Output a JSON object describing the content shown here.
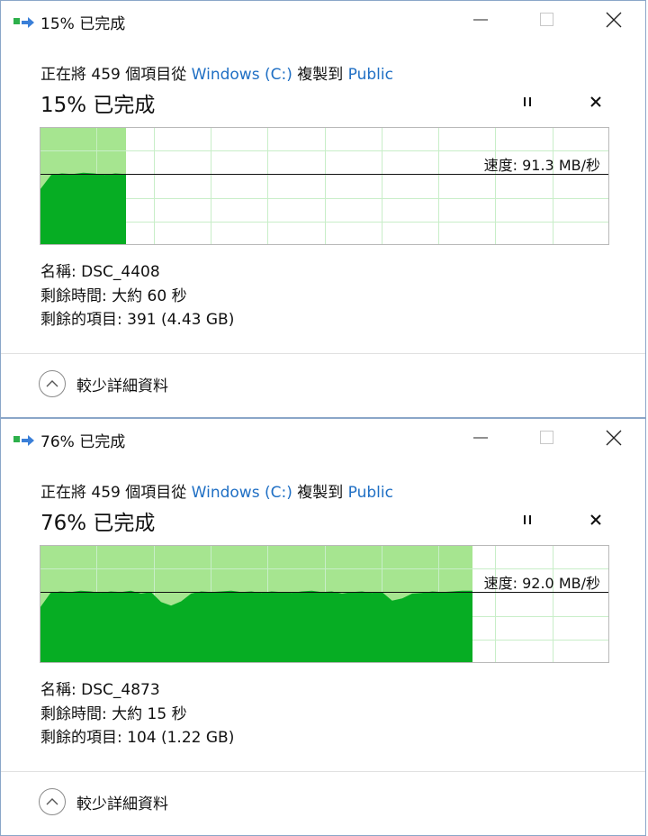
{
  "colors": {
    "accent_link": "#1f6fc4",
    "chart_fill_dark": "#06ad23",
    "chart_fill_light": "#a6e590",
    "chart_grid": "#c8eec8",
    "chart_border": "#b9b9b9",
    "speed_line": "#111111"
  },
  "dialogs": [
    {
      "title": "15% 已完成",
      "copy_prefix": "正在將 459 個項目從 ",
      "source": "Windows (C:)",
      "copy_middle": " 複製到 ",
      "destination": "Public",
      "percent_text": "15% 已完成",
      "progress": 0.15,
      "speed_text": "速度: 91.3 MB/秒",
      "speed_level": 0.4,
      "name_line": "名稱: DSC_4408",
      "time_line": "剩餘時間: 大約 60 秒",
      "items_line": "剩餘的項目: 391 (4.43 GB)",
      "toggle_label": "較少詳細資料",
      "window_buttons": {
        "minimize": "minimize-icon",
        "maximize": "maximize-icon",
        "close": "close-icon"
      }
    },
    {
      "title": "76% 已完成",
      "copy_prefix": "正在將 459 個項目從 ",
      "source": "Windows (C:)",
      "copy_middle": " 複製到 ",
      "destination": "Public",
      "percent_text": "76% 已完成",
      "progress": 0.76,
      "speed_text": "速度: 92.0 MB/秒",
      "speed_level": 0.4,
      "name_line": "名稱: DSC_4873",
      "time_line": "剩餘時間: 大約 15 秒",
      "items_line": "剩餘的項目: 104 (1.22 GB)",
      "toggle_label": "較少詳細資料",
      "window_buttons": {
        "minimize": "minimize-icon",
        "maximize": "maximize-icon",
        "close": "close-icon"
      }
    }
  ]
}
